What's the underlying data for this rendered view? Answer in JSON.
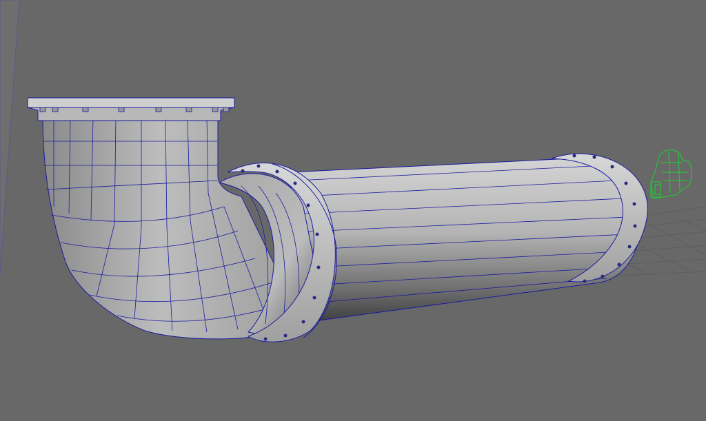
{
  "viewport": {
    "background": "#686868",
    "mesh_fill_light": "#c9c9c9",
    "mesh_fill_dark": "#4a4a4a",
    "wire_color": "#1a1aa0",
    "grid_color": "#5d5d5d",
    "helper_color": "#28c23a"
  },
  "scene": {
    "objects": [
      {
        "name": "pipe-elbow",
        "type": "polygon-mesh"
      },
      {
        "name": "pipe-straight",
        "type": "polygon-mesh"
      },
      {
        "name": "flange-top",
        "type": "polygon-mesh"
      },
      {
        "name": "flange-mid",
        "type": "polygon-mesh"
      },
      {
        "name": "flange-end",
        "type": "polygon-mesh"
      }
    ],
    "helper_object": {
      "name": "camera-helper",
      "display": "wireframe"
    },
    "ground_grid": true
  }
}
